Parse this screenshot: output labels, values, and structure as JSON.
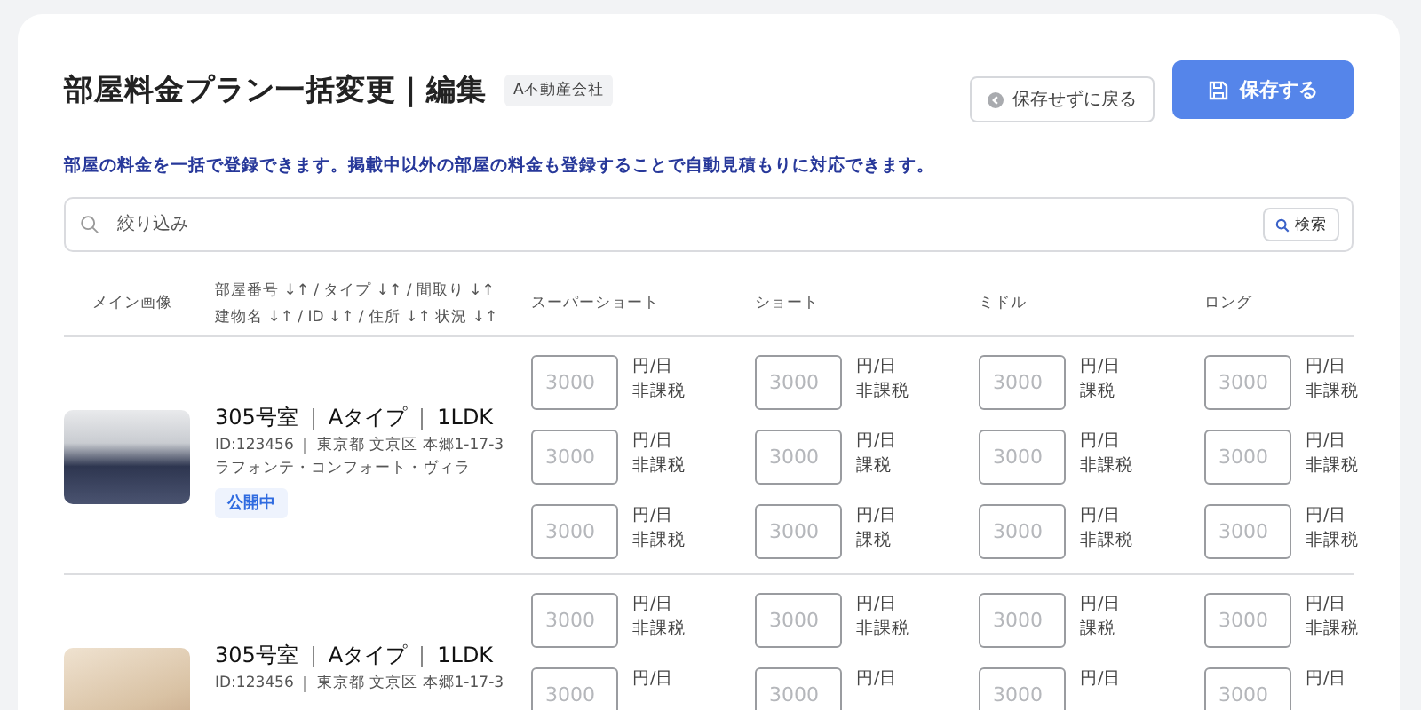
{
  "header": {
    "title": "部屋料金プラン一括変更｜編集",
    "company_tag": "A不動産会社",
    "back_button": "保存せずに戻る",
    "save_button": "保存する"
  },
  "description": "部屋の料金を一括で登録できます。掲載中以外の部屋の料金も登録することで自動見積もりに対応できます。",
  "search": {
    "placeholder": "絞り込み",
    "button": "検索"
  },
  "table": {
    "columns": [
      {
        "lines": [
          "メイン画像"
        ]
      },
      {
        "lines": [
          "部屋番号 ↓↑ / タイプ ↓↑ / 間取り ↓↑",
          "建物名 ↓↑ / ID ↓↑ / 住所 ↓↑ 状況 ↓↑"
        ]
      },
      {
        "lines": [
          "スーパーショート"
        ]
      },
      {
        "lines": [
          "ショート"
        ]
      },
      {
        "lines": [
          "ミドル"
        ]
      },
      {
        "lines": [
          "ロング"
        ]
      }
    ],
    "rows": [
      {
        "title_parts": [
          "305号室",
          "Aタイプ",
          "1LDK"
        ],
        "id": "ID:123456",
        "address": "東京都 文京区 本郷1-17-3",
        "building": "ラフォンテ・コンフォート・ヴィラ",
        "status": "公開中",
        "prices": [
          [
            {
              "placeholder": "3000",
              "unit": "円/日",
              "tax": "非課税"
            },
            {
              "placeholder": "3000",
              "unit": "円/日",
              "tax": "非課税"
            },
            {
              "placeholder": "3000",
              "unit": "円/日",
              "tax": "課税"
            },
            {
              "placeholder": "3000",
              "unit": "円/日",
              "tax": "非課税"
            }
          ],
          [
            {
              "placeholder": "3000",
              "unit": "円/日",
              "tax": "非課税"
            },
            {
              "placeholder": "3000",
              "unit": "円/日",
              "tax": "課税"
            },
            {
              "placeholder": "3000",
              "unit": "円/日",
              "tax": "非課税"
            },
            {
              "placeholder": "3000",
              "unit": "円/日",
              "tax": "非課税"
            }
          ],
          [
            {
              "placeholder": "3000",
              "unit": "円/日",
              "tax": "非課税"
            },
            {
              "placeholder": "3000",
              "unit": "円/日",
              "tax": "課税"
            },
            {
              "placeholder": "3000",
              "unit": "円/日",
              "tax": "非課税"
            },
            {
              "placeholder": "3000",
              "unit": "円/日",
              "tax": "非課税"
            }
          ]
        ]
      },
      {
        "title_parts": [
          "305号室",
          "Aタイプ",
          "1LDK"
        ],
        "id": "ID:123456",
        "address": "東京都 文京区 本郷1-17-3",
        "prices": [
          [
            {
              "placeholder": "3000",
              "unit": "円/日",
              "tax": "非課税"
            },
            {
              "placeholder": "3000",
              "unit": "円/日",
              "tax": "非課税"
            },
            {
              "placeholder": "3000",
              "unit": "円/日",
              "tax": "課税"
            },
            {
              "placeholder": "3000",
              "unit": "円/日",
              "tax": "非課税"
            }
          ],
          [
            {
              "placeholder": "3000",
              "unit": "円/日"
            },
            {
              "placeholder": "3000",
              "unit": "円/日"
            },
            {
              "placeholder": "3000",
              "unit": "円/日"
            },
            {
              "placeholder": "3000",
              "unit": "円/日"
            }
          ]
        ]
      }
    ]
  }
}
